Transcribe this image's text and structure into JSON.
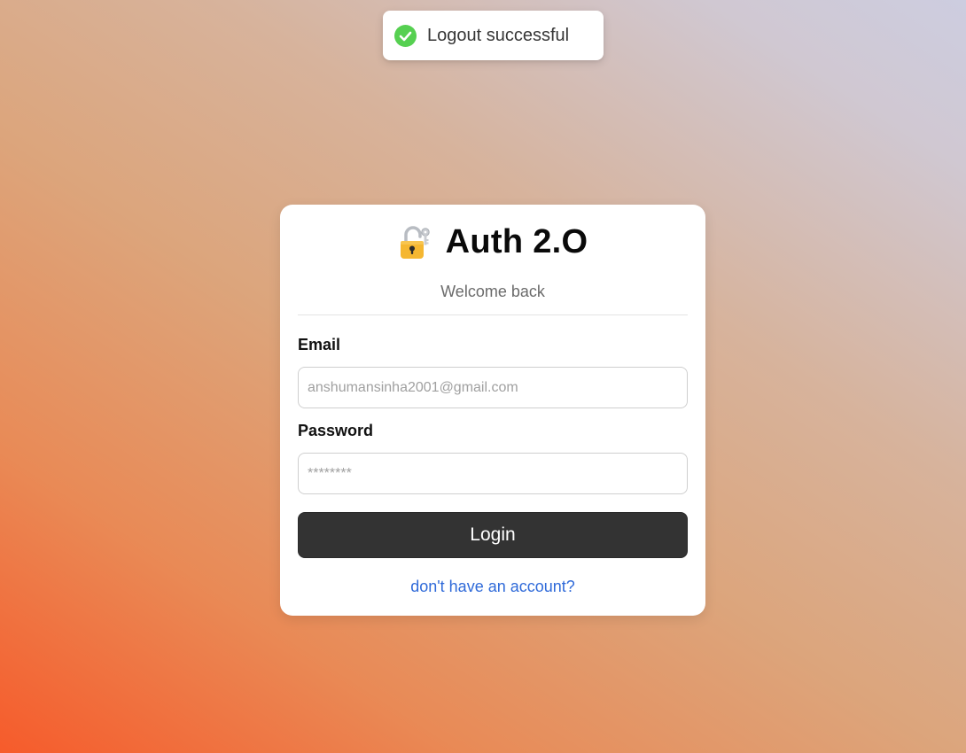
{
  "toast": {
    "icon": "check-circle-icon",
    "message": "Logout successful",
    "status_color": "#56d051"
  },
  "card": {
    "icon": "lock-with-key-icon",
    "title": "Auth 2.O",
    "subtitle": "Welcome back",
    "email": {
      "label": "Email",
      "placeholder": "anshumansinha2001@gmail.com",
      "value": ""
    },
    "password": {
      "label": "Password",
      "placeholder": "********",
      "value": ""
    },
    "login_button": "Login",
    "signup_link": "don't have an account?"
  },
  "colors": {
    "button_bg": "#333333",
    "link": "#2f6ad9",
    "gradient_start": "#f65b2b",
    "gradient_end": "#cdcde0"
  }
}
